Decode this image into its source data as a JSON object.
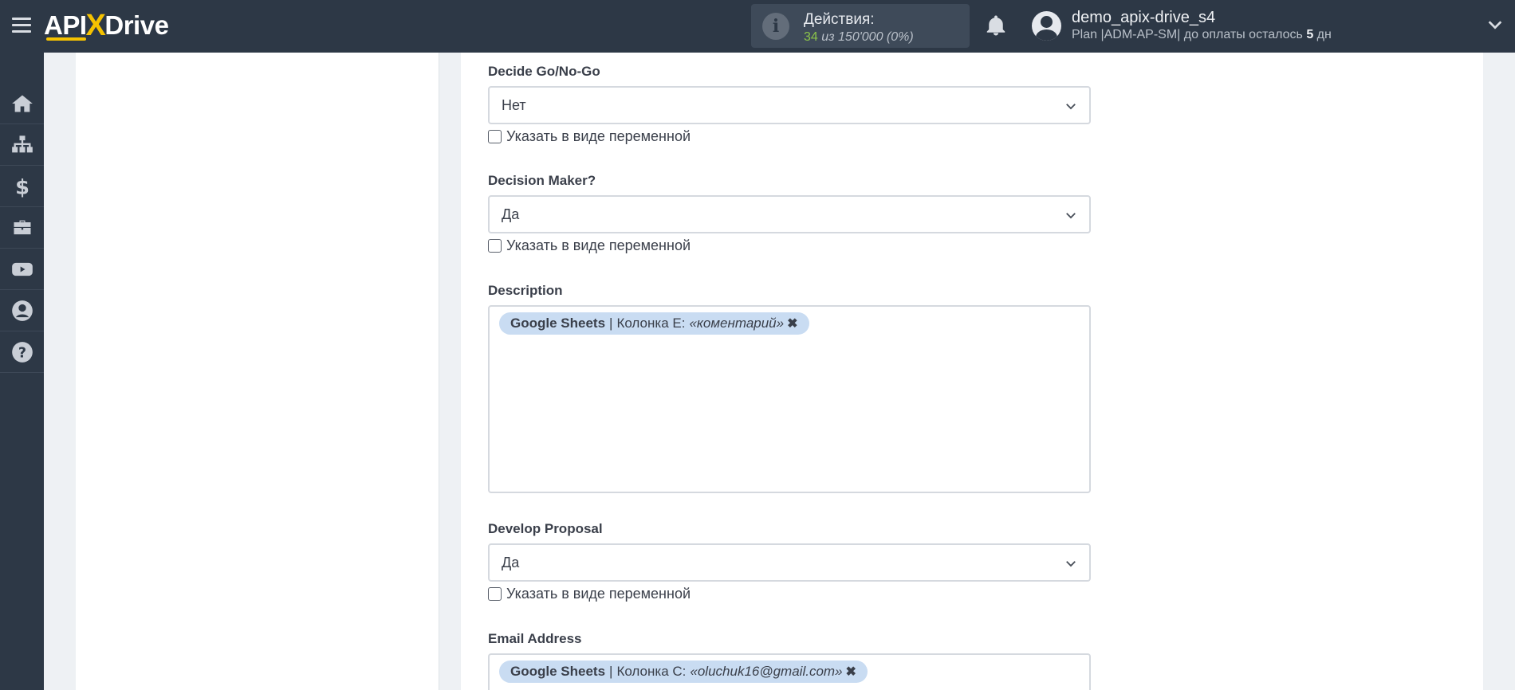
{
  "header": {
    "logo_text_a": "API",
    "logo_text_x": "X",
    "logo_text_b": "Drive",
    "actions_label": "Действия:",
    "actions_used": "34",
    "actions_of": " из 150'000 ",
    "actions_percent": "(0%)",
    "username": "demo_apix-drive_s4",
    "plan_prefix": "Plan |ADM-AP-SM| до оплаты осталось ",
    "plan_days": "5",
    "plan_suffix": " дн"
  },
  "sidebar": {
    "icons": [
      "home-icon",
      "sitemap-icon",
      "dollar-icon",
      "briefcase-icon",
      "youtube-icon",
      "user-circle-icon",
      "help-icon"
    ]
  },
  "form": {
    "checkbox_label": "Указать в виде переменной",
    "fields": [
      {
        "label": "Decide Go/No-Go",
        "value": "Нет"
      },
      {
        "label": "Decision Maker?",
        "value": "Да"
      },
      {
        "label": "Description"
      },
      {
        "label": "Develop Proposal",
        "value": "Да"
      },
      {
        "label": "Email Address"
      }
    ],
    "description_tag": {
      "source": "Google Sheets",
      "sep": "|",
      "column": "Колонка E:",
      "value": "«коментарий»",
      "close": "✖"
    },
    "email_tag": {
      "source": "Google Sheets",
      "sep": "|",
      "column": "Колонка C:",
      "value": "«oluchuk16@gmail.com»",
      "close": "✖"
    }
  },
  "colors": {
    "topbar": "#2d3846",
    "accent_yellow": "#f5c200",
    "tag_bg": "#c9dcf2",
    "used_green": "#8bc34a"
  }
}
